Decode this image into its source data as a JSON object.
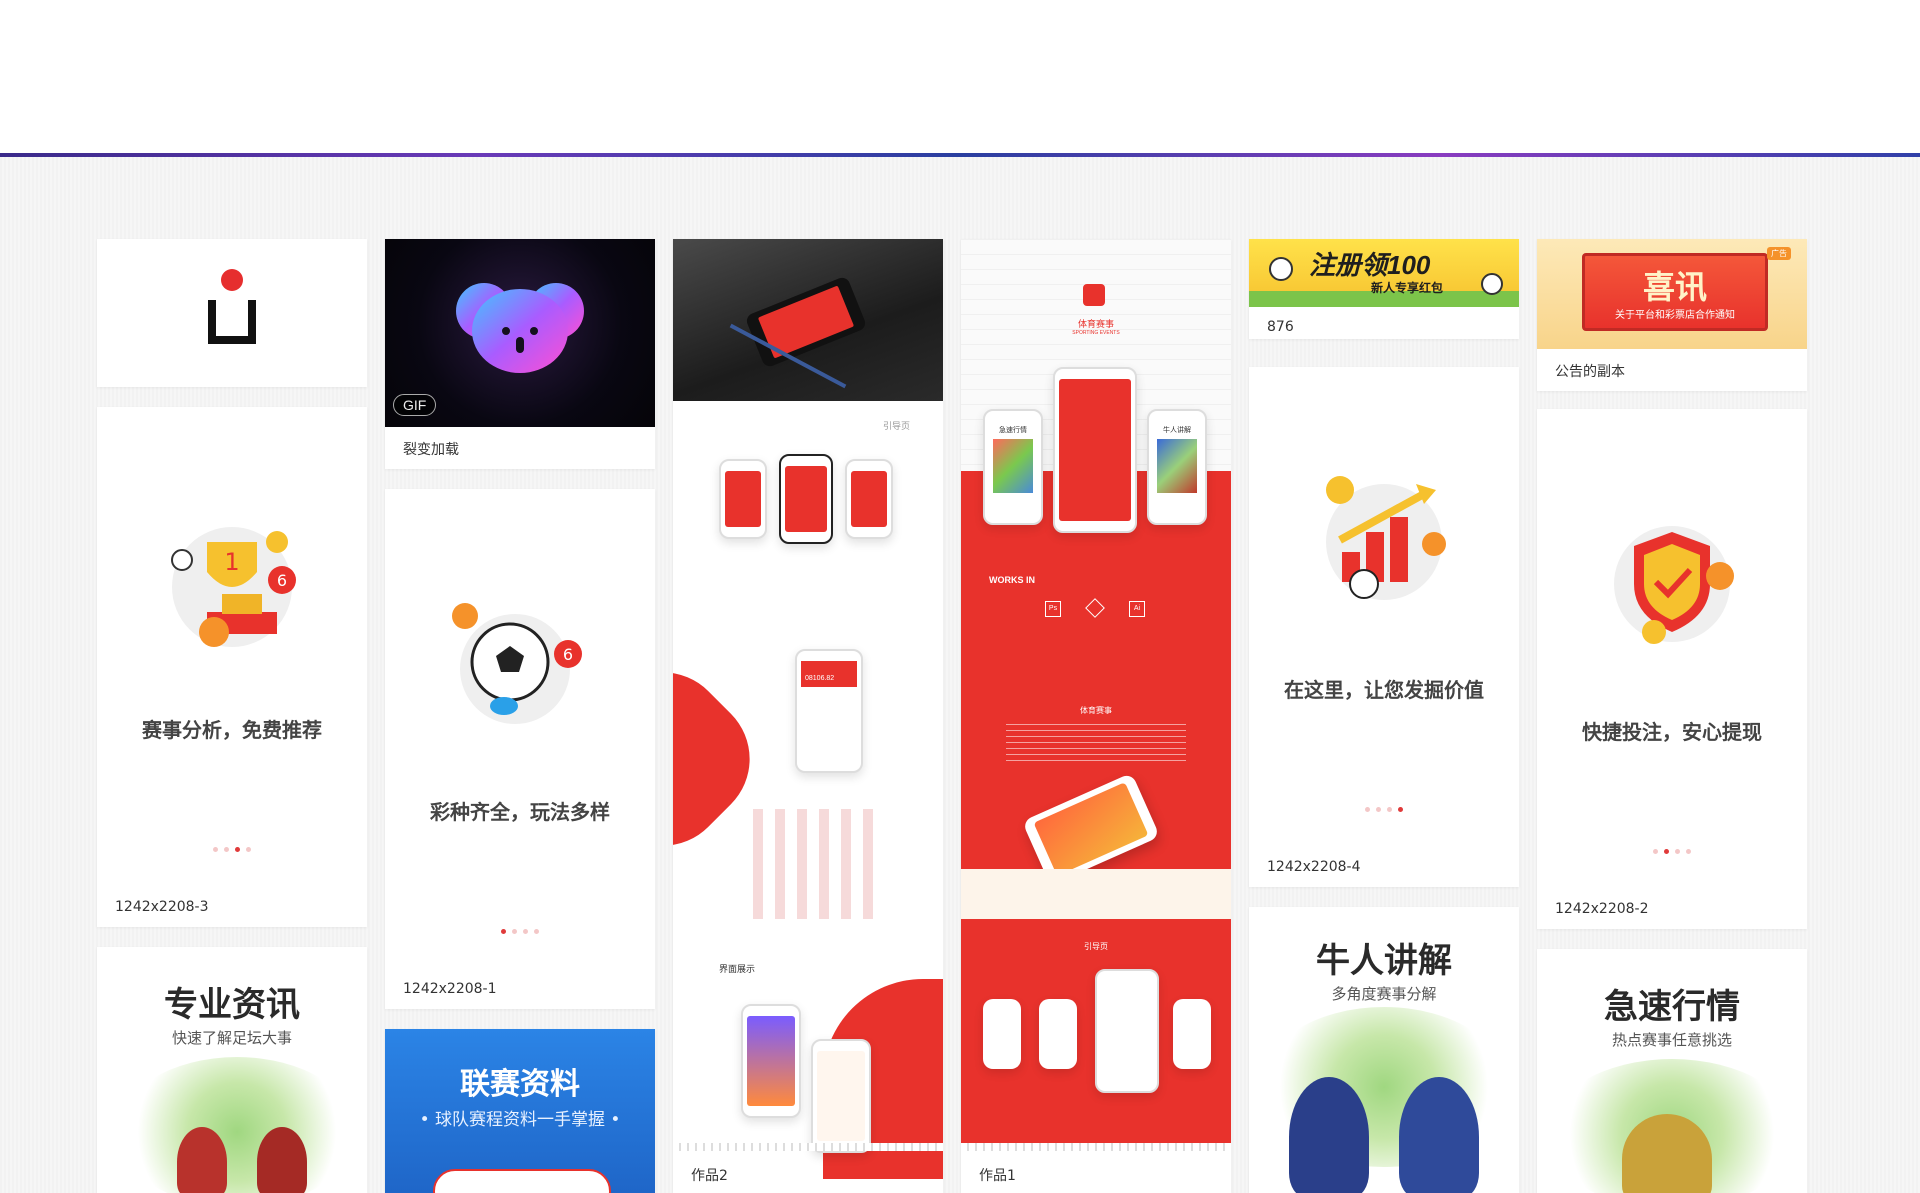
{
  "cards": {
    "logo": {},
    "fission_loading": {
      "badge": "GIF",
      "caption": "裂变加载"
    },
    "welcome3": {
      "phrase": "赛事分析，免费推荐",
      "caption": "1242x2208-3"
    },
    "welcome1": {
      "phrase": "彩种齐全，玩法多样",
      "caption": "1242x2208-1"
    },
    "welcome4": {
      "phrase": "在这里，让您发掘价值",
      "caption": "1242x2208-4"
    },
    "welcome2": {
      "phrase": "快捷投注，安心提现",
      "caption": "1242x2208-2"
    },
    "banner876": {
      "banner_title": "注册领100",
      "banner_sub": "新人专享红包",
      "caption": "876"
    },
    "notice": {
      "tag": "广告",
      "title": "喜讯",
      "sub": "关于平台和彩票店合作通知",
      "caption": "公告的副本"
    },
    "pro_news": {
      "title": "专业资讯",
      "sub": "快速了解足坛大事"
    },
    "league": {
      "title": "联赛资料",
      "sub": "• 球队赛程资料一手掌握 •"
    },
    "expert": {
      "title": "牛人讲解",
      "sub": "多角度赛事分解"
    },
    "fast_odds": {
      "title": "急速行情",
      "sub": "热点赛事任意挑选"
    },
    "works2": {
      "label_top": "引导页",
      "label_mid": "界面展示",
      "number": "08106.82",
      "caption": "作品2"
    },
    "works1": {
      "app_name": "体育赛事",
      "app_sub": "SPORTING EVENTS",
      "phone_left": "急速行情",
      "phone_right": "牛人讲解",
      "works_in": "WORKS IN",
      "tool_ps": "Ps",
      "tool_ai": "Ai",
      "section_title": "体育赛事",
      "guide": "引导页",
      "caption": "作品1"
    }
  },
  "colors": {
    "brand_red": "#e8322c",
    "blue_banner": "#2a7ee0",
    "page_bg": "#f4f4f4"
  }
}
